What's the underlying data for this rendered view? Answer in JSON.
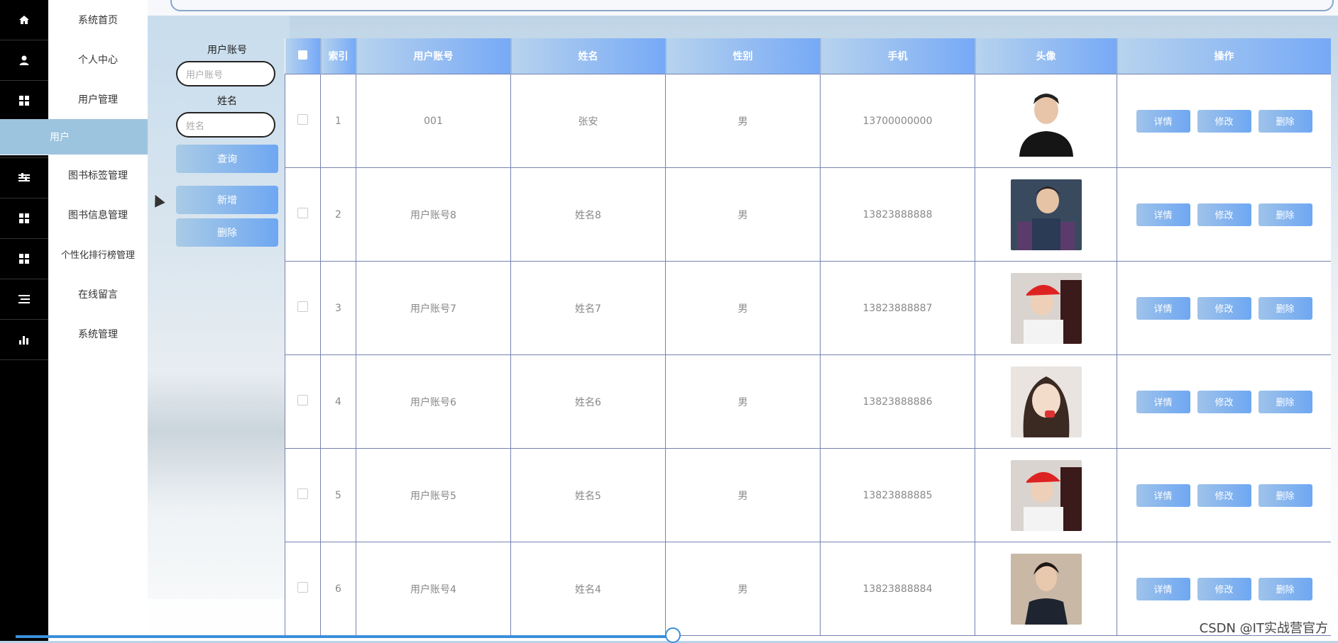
{
  "rail": [
    "home-icon",
    "user-icon",
    "grid-icon",
    "",
    "sliders-icon",
    "grid-icon",
    "grid-icon",
    "list-icon",
    "bar-chart-icon"
  ],
  "menu": [
    {
      "label": "系统首页"
    },
    {
      "label": "个人中心"
    },
    {
      "label": "用户管理"
    },
    {
      "label": "用户",
      "sub": true
    },
    {
      "label": "图书标签管理"
    },
    {
      "label": "图书信息管理"
    },
    {
      "label": "个性化排行榜管理"
    },
    {
      "label": "在线留言"
    },
    {
      "label": "系统管理"
    }
  ],
  "search": {
    "account_label": "用户账号",
    "account_placeholder": "用户账号",
    "name_label": "姓名",
    "name_placeholder": "姓名",
    "query_button": "查询",
    "add_button": "新增",
    "delete_button": "删除"
  },
  "table": {
    "headers": [
      "索引",
      "用户账号",
      "姓名",
      "性别",
      "手机",
      "头像",
      "操作"
    ],
    "rows": [
      {
        "index": "1",
        "account": "001",
        "name": "张安",
        "gender": "男",
        "phone": "13700000000",
        "avatar": "avatar-1"
      },
      {
        "index": "2",
        "account": "用户账号8",
        "name": "姓名8",
        "gender": "男",
        "phone": "13823888888",
        "avatar": "avatar-2"
      },
      {
        "index": "3",
        "account": "用户账号7",
        "name": "姓名7",
        "gender": "男",
        "phone": "13823888887",
        "avatar": "avatar-3"
      },
      {
        "index": "4",
        "account": "用户账号6",
        "name": "姓名6",
        "gender": "男",
        "phone": "13823888886",
        "avatar": "avatar-4"
      },
      {
        "index": "5",
        "account": "用户账号5",
        "name": "姓名5",
        "gender": "男",
        "phone": "13823888885",
        "avatar": "avatar-5"
      },
      {
        "index": "6",
        "account": "用户账号4",
        "name": "姓名4",
        "gender": "男",
        "phone": "13823888884",
        "avatar": "avatar-6"
      }
    ],
    "ops": {
      "detail": "详情",
      "edit": "修改",
      "delete": "删除"
    }
  },
  "watermark": "CSDN @IT实战营官方"
}
